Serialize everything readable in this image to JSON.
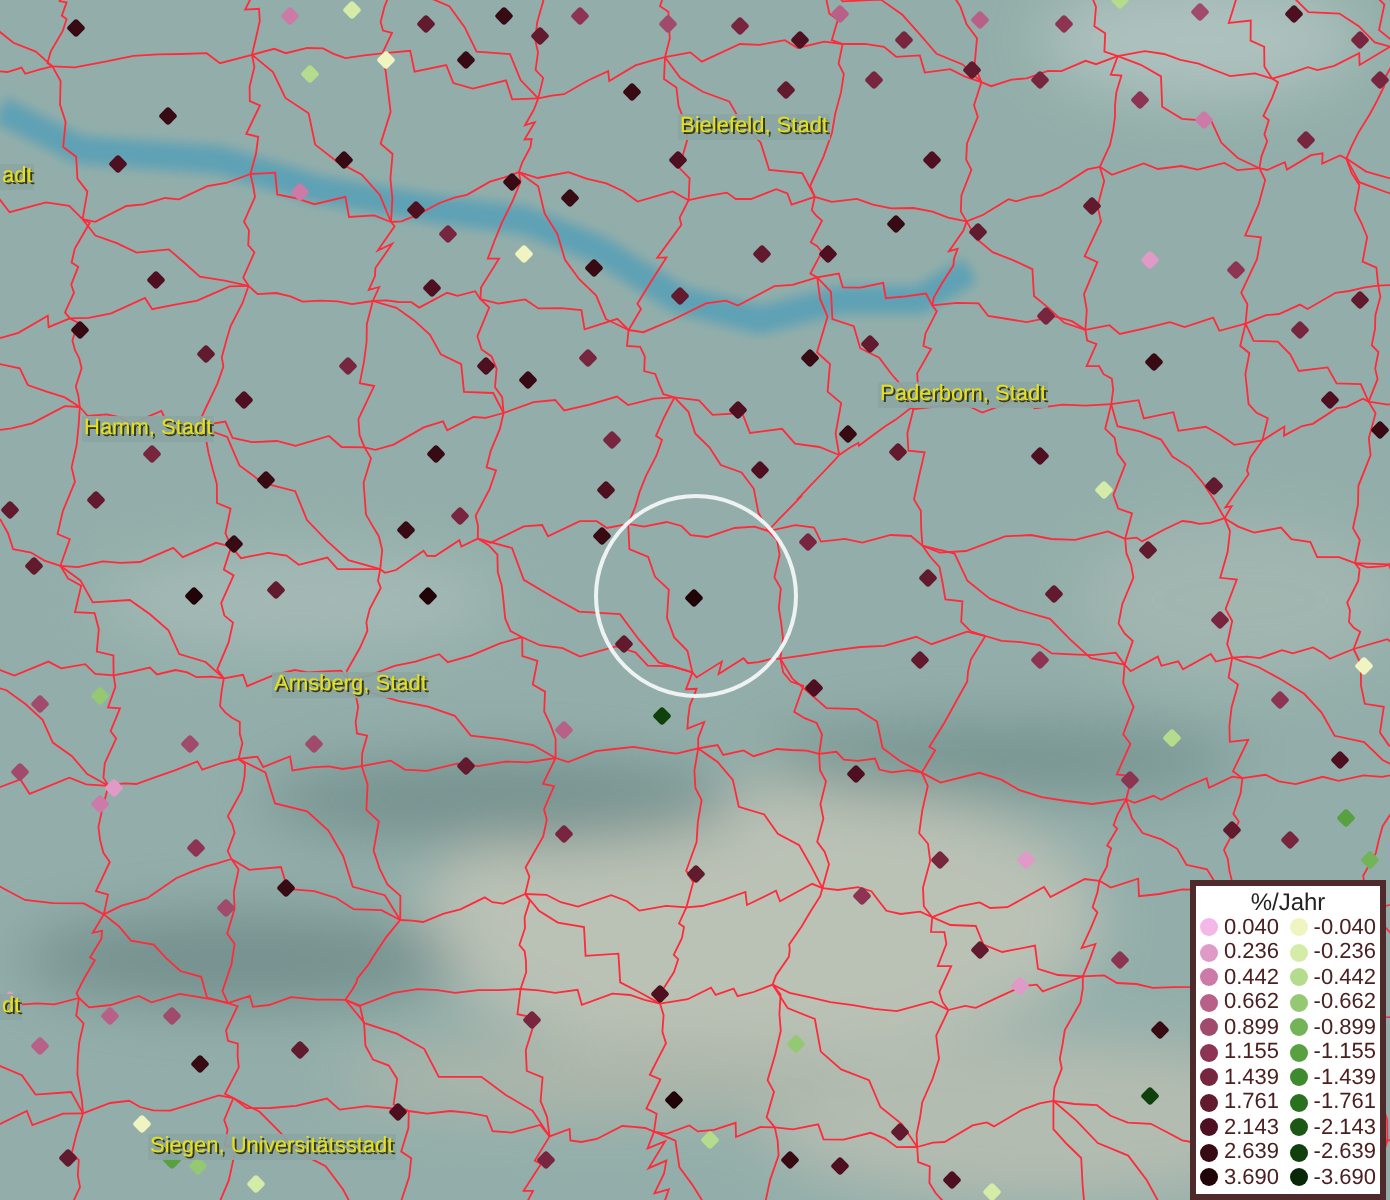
{
  "map": {
    "labels": [
      {
        "text": "Bielefeld, Stadt"
      },
      {
        "text": "adt"
      },
      {
        "text": "Paderborn, Stadt"
      },
      {
        "text": "Hamm, Stadt"
      },
      {
        "text": "Arnsberg, Stadt"
      },
      {
        "text": "dt"
      },
      {
        "text": "Siegen, Universitätsstadt"
      }
    ]
  },
  "legend": {
    "title": "%/Jahr",
    "positive": [
      {
        "value": "0.040",
        "color": "#f4b8e8"
      },
      {
        "value": "0.236",
        "color": "#e09ac8"
      },
      {
        "value": "0.442",
        "color": "#cc7aa8"
      },
      {
        "value": "0.662",
        "color": "#b86088"
      },
      {
        "value": "0.899",
        "color": "#a04a6c"
      },
      {
        "value": "1.155",
        "color": "#8c3452"
      },
      {
        "value": "1.439",
        "color": "#782640"
      },
      {
        "value": "1.761",
        "color": "#621a2e"
      },
      {
        "value": "2.143",
        "color": "#4e1020"
      },
      {
        "value": "2.639",
        "color": "#380a14"
      },
      {
        "value": "3.690",
        "color": "#200408"
      }
    ],
    "negative": [
      {
        "value": "-0.040",
        "color": "#f0f4c0"
      },
      {
        "value": "-0.236",
        "color": "#d4eca8"
      },
      {
        "value": "-0.442",
        "color": "#b4dc8c"
      },
      {
        "value": "-0.662",
        "color": "#94c872"
      },
      {
        "value": "-0.899",
        "color": "#74b458"
      },
      {
        "value": "-1.155",
        "color": "#58a040"
      },
      {
        "value": "-1.439",
        "color": "#3e8a2e"
      },
      {
        "value": "-1.761",
        "color": "#2a7020"
      },
      {
        "value": "-2.143",
        "color": "#1c5814"
      },
      {
        "value": "-2.639",
        "color": "#10400c"
      },
      {
        "value": "-3.690",
        "color": "#082808"
      }
    ]
  }
}
